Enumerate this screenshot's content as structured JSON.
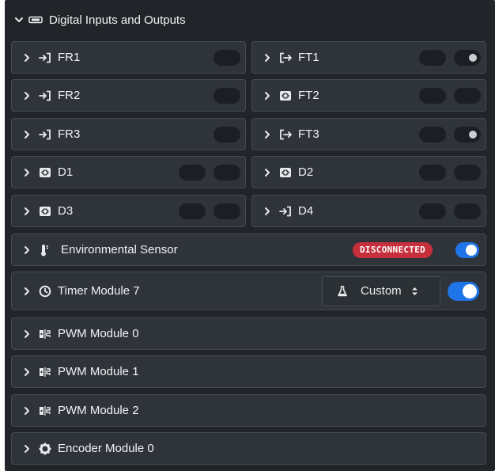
{
  "section": {
    "title": "Digital Inputs and Outputs",
    "header_icon": "io-port-icon",
    "chevron": "chevron-down-icon"
  },
  "colors": {
    "panel_bg": "#212529",
    "card_bg": "#2f343a",
    "toggle_on": "#1f74e8",
    "badge_red": "#c62f3c"
  },
  "grid": [
    {
      "left": {
        "label": "FR1",
        "icon": "input-arrow-icon",
        "pills": [
          {
            "dot": false
          }
        ]
      },
      "right": {
        "label": "FT1",
        "icon": "output-arrow-icon",
        "pills": [
          {
            "dot": false
          },
          {
            "dot": true
          }
        ]
      }
    },
    {
      "left": {
        "label": "FR2",
        "icon": "input-arrow-icon",
        "pills": [
          {
            "dot": false
          }
        ]
      },
      "right": {
        "label": "FT2",
        "icon": "bidirectional-icon",
        "pills": [
          {
            "dot": false
          },
          {
            "dot": false
          }
        ]
      }
    },
    {
      "left": {
        "label": "FR3",
        "icon": "input-arrow-icon",
        "pills": [
          {
            "dot": false
          }
        ]
      },
      "right": {
        "label": "FT3",
        "icon": "output-arrow-icon",
        "pills": [
          {
            "dot": false
          },
          {
            "dot": true
          }
        ]
      }
    },
    {
      "left": {
        "label": "D1",
        "icon": "bidirectional-icon",
        "pills": [
          {
            "dot": false
          },
          {
            "dot": false
          }
        ]
      },
      "right": {
        "label": "D2",
        "icon": "bidirectional-icon",
        "pills": [
          {
            "dot": false
          },
          {
            "dot": false
          }
        ]
      }
    },
    {
      "left": {
        "label": "D3",
        "icon": "bidirectional-icon",
        "pills": [
          {
            "dot": false
          },
          {
            "dot": false
          }
        ]
      },
      "right": {
        "label": "D4",
        "icon": "input-arrow-icon",
        "pills": [
          {
            "dot": false
          },
          {
            "dot": false
          }
        ]
      }
    }
  ],
  "environmental": {
    "label": "Environmental Sensor",
    "icon": "thermometer-icon",
    "status": "DISCONNECTED",
    "enabled": true
  },
  "timer": {
    "label": "Timer Module 7",
    "icon": "clock-icon",
    "mode_value": "Custom",
    "enabled": true
  },
  "modules": [
    {
      "label": "PWM Module 0",
      "icon": "pwm-icon"
    },
    {
      "label": "PWM Module 1",
      "icon": "pwm-icon"
    },
    {
      "label": "PWM Module 2",
      "icon": "pwm-icon"
    },
    {
      "label": "Encoder Module 0",
      "icon": "encoder-gear-icon"
    }
  ]
}
